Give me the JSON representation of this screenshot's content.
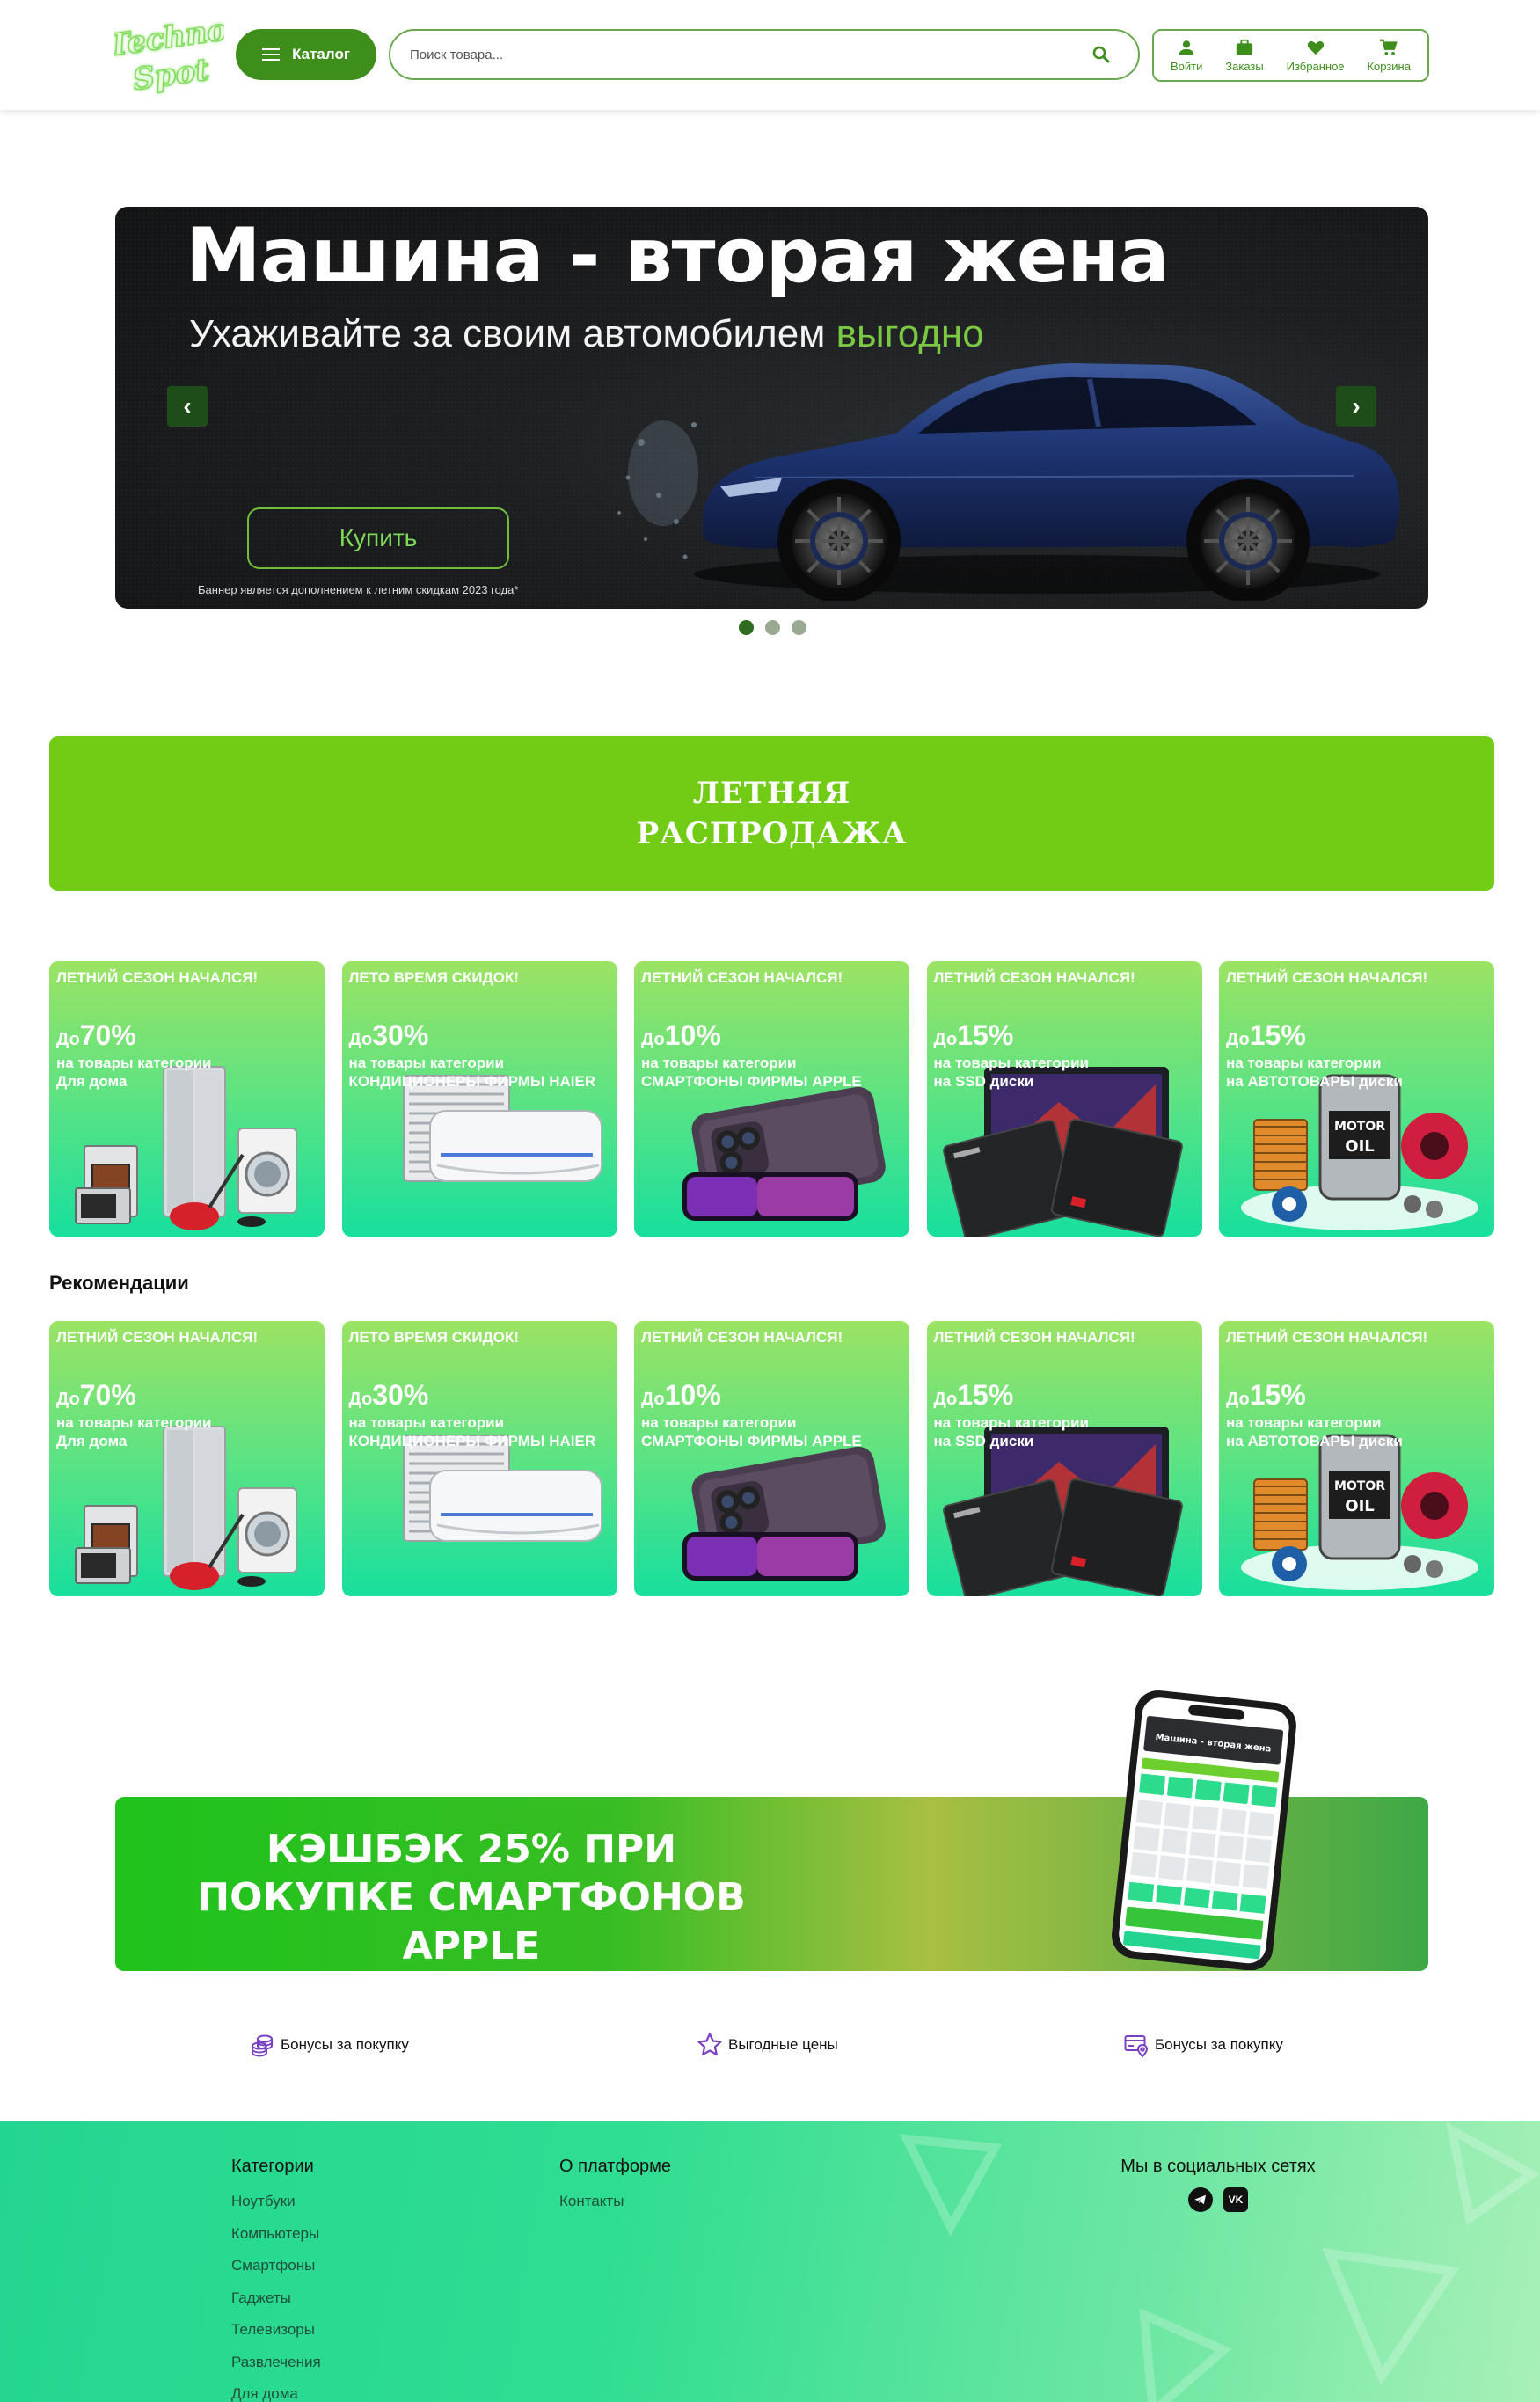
{
  "logo": {
    "line1": "Techno",
    "line2": "Spot"
  },
  "header": {
    "catalog_label": "Каталог",
    "search_placeholder": "Поиск товара...",
    "menu": [
      {
        "label": "Войти",
        "icon": "user-icon"
      },
      {
        "label": "Заказы",
        "icon": "briefcase-icon"
      },
      {
        "label": "Избранное",
        "icon": "heart-icon"
      },
      {
        "label": "Корзина",
        "icon": "cart-icon"
      }
    ]
  },
  "hero": {
    "title": "Машина - вторая жена",
    "subtitle_main": "Ухаживайте за своим автомобилем ",
    "subtitle_accent": "выгодно",
    "button": "Купить",
    "note": "Баннер является дополнением к летним скидкам 2023 года*",
    "prev": "‹",
    "next": "›",
    "slides": 3,
    "active_slide": 1
  },
  "sale_banner": {
    "line1": "ЛЕТНЯЯ",
    "line2": "РАСПРОДАЖА"
  },
  "promos": [
    {
      "head": "ЛЕТНИЙ СЕЗОН НАЧАЛСЯ!",
      "pre": "До",
      "num": "70%",
      "line1": "на товары категории",
      "line2": "Для дома",
      "art": "appliances"
    },
    {
      "head": "ЛЕТО ВРЕМЯ СКИДОК!",
      "pre": "До",
      "num": "30%",
      "line1": "на товары категории",
      "line2": "КОНДИЦИОНЕРЫ ФИРМЫ HAIER",
      "art": "aircon"
    },
    {
      "head": "ЛЕТНИЙ СЕЗОН НАЧАЛСЯ!",
      "pre": "До",
      "num": "10%",
      "line1": "на товары категории",
      "line2": "СМАРТФОНЫ ФИРМЫ APPLE",
      "art": "iphone"
    },
    {
      "head": "ЛЕТНИЙ СЕЗОН НАЧАЛСЯ!",
      "pre": "До",
      "num": "15%",
      "line1": "на товары категории",
      "line2": "на SSD диски",
      "art": "ssd"
    },
    {
      "head": "ЛЕТНИЙ СЕЗОН НАЧАЛСЯ!",
      "pre": "До",
      "num": "15%",
      "line1": "на товары категории",
      "line2": "на АВТОТОВАРЫ диски",
      "art": "auto"
    }
  ],
  "recommendations_title": "Рекомендации",
  "cashback": {
    "line1": "КЭШБЭК 25% ПРИ",
    "line2": "ПОКУПКЕ СМАРТФОНОВ",
    "line3": "APPLE",
    "phone_title": "Машина - вторая жена"
  },
  "features": [
    {
      "label": "Бонусы за покупку",
      "icon": "coins-icon"
    },
    {
      "label": "Выгодные цены",
      "icon": "star-icon"
    },
    {
      "label": "Бонусы за покупку",
      "icon": "card-location-icon"
    }
  ],
  "footer": {
    "categories_title": "Категории",
    "categories": [
      "Ноутбуки",
      "Компьютеры",
      "Смартфоны",
      "Гаджеты",
      "Телевизоры",
      "Развлечения",
      "Для дома"
    ],
    "platform_title": "О платформе",
    "platform_links": [
      "Контакты"
    ],
    "social_title": "Мы в социальных сетях",
    "socials": [
      {
        "name": "telegram-icon",
        "label": ""
      },
      {
        "name": "vk-icon",
        "label": "VK"
      }
    ]
  },
  "colors": {
    "brand_green": "#3e8e1c",
    "sale_green": "#72cc16",
    "accent_light": "#7ac943",
    "feature_purple": "#7b3fc4"
  }
}
